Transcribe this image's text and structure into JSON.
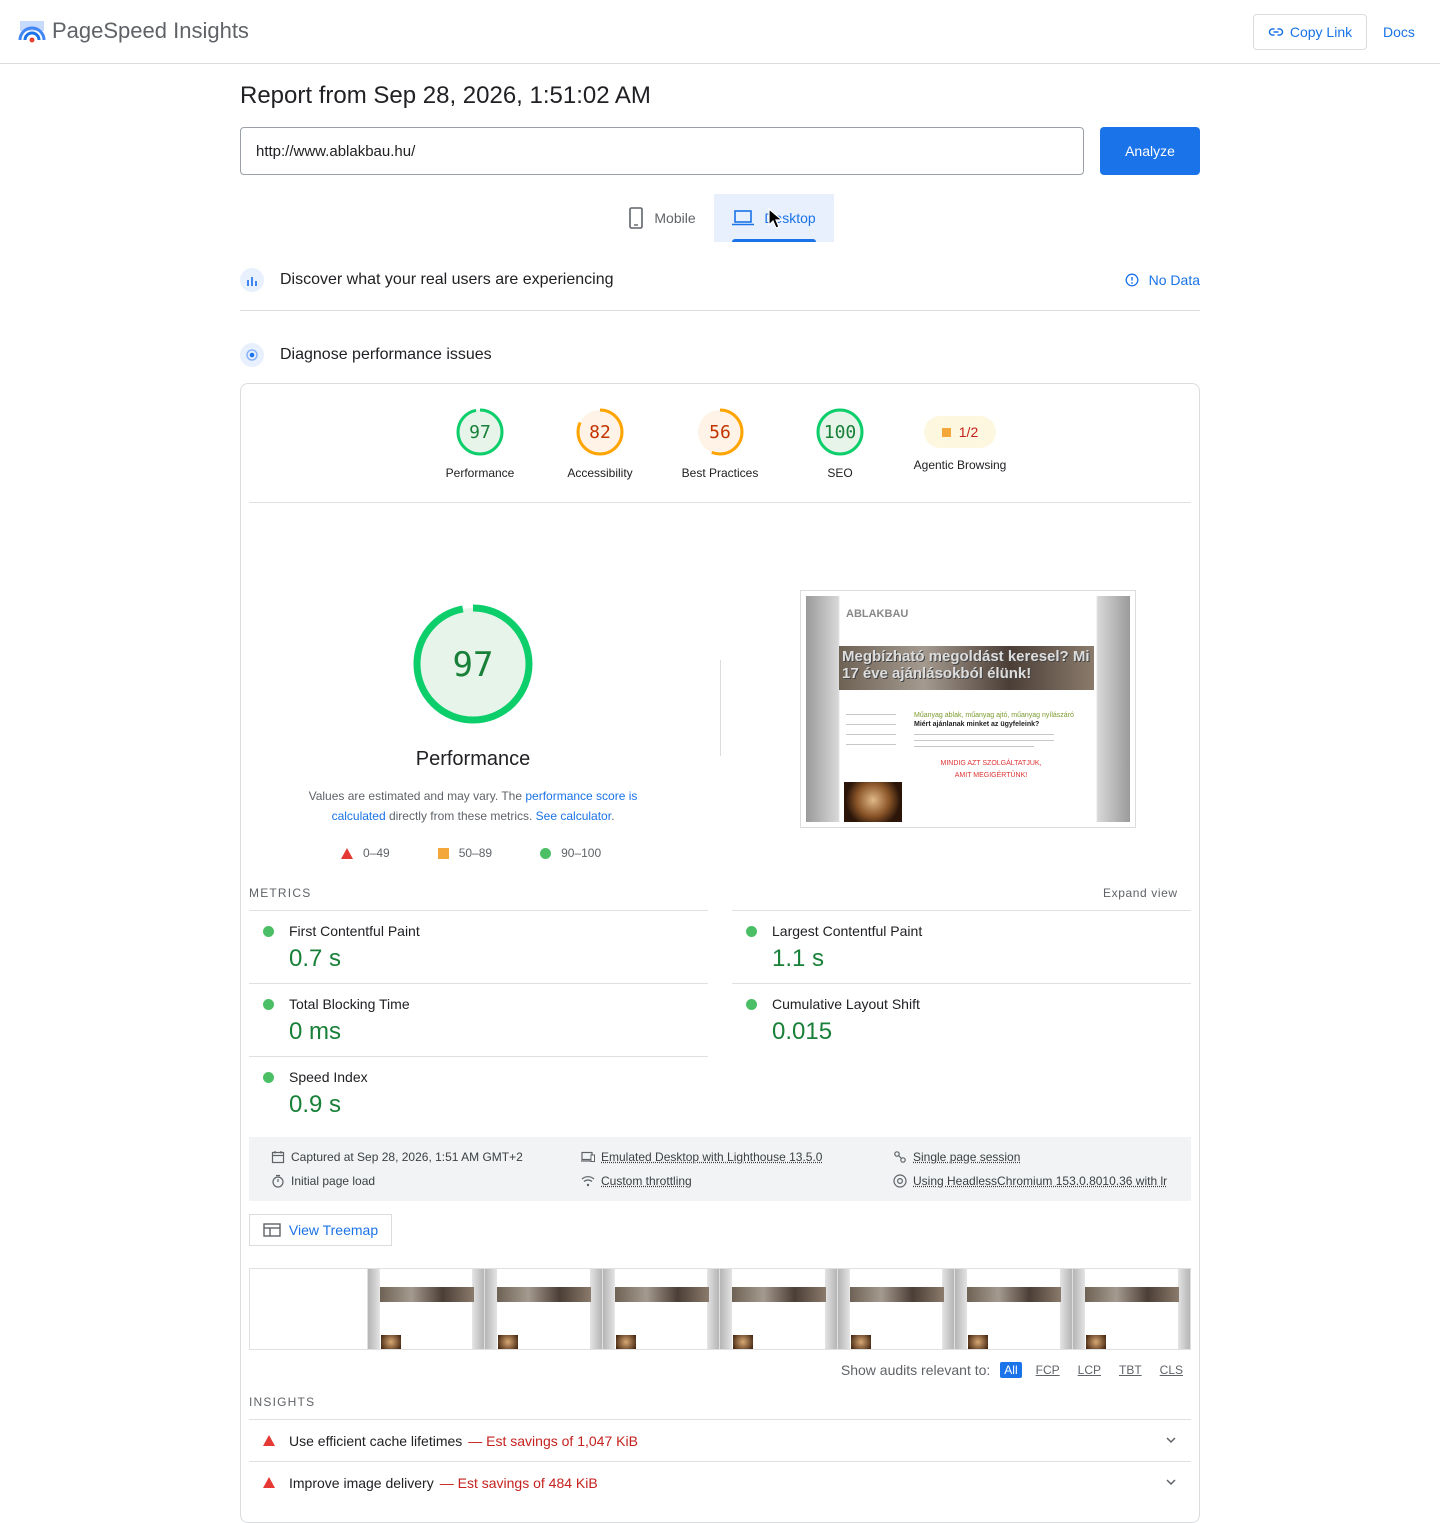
{
  "header": {
    "brand": "PageSpeed Insights",
    "copy_link": "Copy Link",
    "docs": "Docs"
  },
  "report": {
    "title": "Report from Sep 28, 2026, 1:51:02 AM",
    "url_value": "http://www.ablakbau.hu/",
    "analyze": "Analyze"
  },
  "tabs": {
    "mobile": "Mobile",
    "desktop": "Desktop",
    "selected": "desktop"
  },
  "sections": {
    "discover": "Discover what your real users are experiencing",
    "no_data": "No Data",
    "diagnose": "Diagnose performance issues"
  },
  "gauges": [
    {
      "label": "Performance",
      "score": "97",
      "value": 97,
      "color": "#0cce6b",
      "text_color": "#188038",
      "bg": "#e6f4ea"
    },
    {
      "label": "Accessibility",
      "score": "82",
      "value": 82,
      "color": "#ffa400",
      "text_color": "#c33300",
      "bg": "#fef3e6"
    },
    {
      "label": "Best Practices",
      "score": "56",
      "value": 56,
      "color": "#ffa400",
      "text_color": "#c33300",
      "bg": "#fef3e6"
    },
    {
      "label": "SEO",
      "score": "100",
      "value": 100,
      "color": "#0cce6b",
      "text_color": "#188038",
      "bg": "#e6f4ea"
    }
  ],
  "agentic": {
    "label": "Agentic Browsing",
    "score": "1/2"
  },
  "performance": {
    "score": "97",
    "value": 97,
    "label": "Performance",
    "estimate_prefix": "Values are estimated and may vary. The ",
    "estimate_link": "performance score is calculated",
    "estimate_mid": " directly from these metrics. ",
    "calculator_link": "See calculator",
    "estimate_suffix": "."
  },
  "legend": {
    "poor": "0–49",
    "average": "50–89",
    "good": "90–100"
  },
  "screenshot": {
    "logo_text": "ABLAKBAU",
    "banner_text": "Megbízható megoldást keresel? Mi 17 éve ajánlásokból élünk!",
    "sub_text": "Műanyag ablak, műanyag ajtó, műanyag nyílászáró",
    "heading_text": "Miért ajánlanak minket az ügyfeleink?",
    "red_text": "MINDIG AZT SZOLGÁLTATJUK, AMIT MEGIGÉRTÜNK!"
  },
  "metrics": {
    "header": "METRICS",
    "expand": "Expand view",
    "items": [
      {
        "label": "First Contentful Paint",
        "value": "0.7 s"
      },
      {
        "label": "Largest Contentful Paint",
        "value": "1.1 s"
      },
      {
        "label": "Total Blocking Time",
        "value": "0 ms"
      },
      {
        "label": "Cumulative Layout Shift",
        "value": "0.015"
      },
      {
        "label": "Speed Index",
        "value": "0.9 s"
      }
    ]
  },
  "info": {
    "captured": "Captured at Sep 28, 2026, 1:51 AM GMT+2",
    "initial": "Initial page load",
    "emulated": "Emulated Desktop with Lighthouse 13.5.0",
    "throttling": "Custom throttling",
    "session": "Single page session",
    "browser": "Using HeadlessChromium 153.0.8010.36 with lr"
  },
  "treemap": "View Treemap",
  "filter": {
    "label": "Show audits relevant to:",
    "chips": [
      "All",
      "FCP",
      "LCP",
      "TBT",
      "CLS"
    ]
  },
  "insights": {
    "header": "INSIGHTS",
    "items": [
      {
        "label": "Use efficient cache lifetimes",
        "savings": "— Est savings of 1,047 KiB"
      },
      {
        "label": "Improve image delivery",
        "savings": "— Est savings of 484 KiB"
      }
    ]
  },
  "colors": {
    "accent": "#1a73e8",
    "good": "#0cce6b",
    "average": "#ffa400",
    "poor": "#e53935"
  }
}
